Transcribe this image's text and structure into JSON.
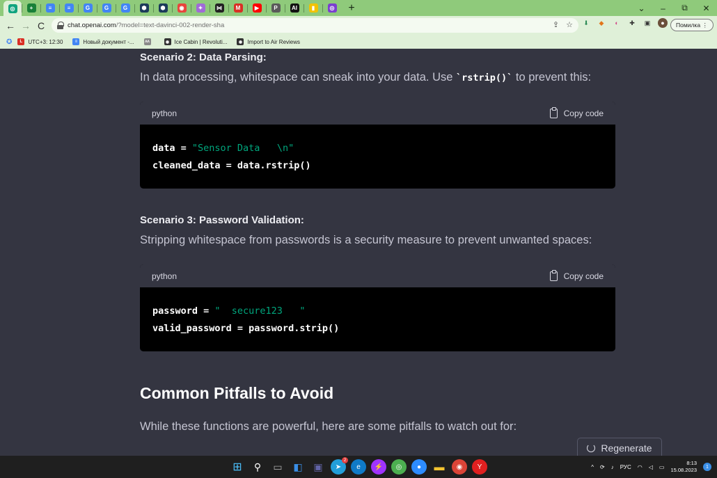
{
  "browser": {
    "tabs": [
      {
        "icon": "chatgpt-icon",
        "color": "#10a37f",
        "glyph": "◎",
        "active": true
      },
      {
        "icon": "sheets-plus-icon",
        "color": "#188038",
        "glyph": "+"
      },
      {
        "icon": "docs-icon",
        "color": "#4285f4",
        "glyph": "≡"
      },
      {
        "icon": "docs-icon",
        "color": "#4285f4",
        "glyph": "≡"
      },
      {
        "icon": "translate-icon",
        "color": "#4285f4",
        "glyph": "G"
      },
      {
        "icon": "translate-icon",
        "color": "#4285f4",
        "glyph": "G"
      },
      {
        "icon": "translate-icon",
        "color": "#4285f4",
        "glyph": "G"
      },
      {
        "icon": "hexagon-icon",
        "color": "#1c3b5a",
        "glyph": "⬢"
      },
      {
        "icon": "hexagon-icon",
        "color": "#1c3b5a",
        "glyph": "⬢"
      },
      {
        "icon": "target-icon",
        "color": "#e8453c",
        "glyph": "◉"
      },
      {
        "icon": "sparkle-icon",
        "color": "#a06bd8",
        "glyph": "✦"
      },
      {
        "icon": "bowtie-icon",
        "color": "#222222",
        "glyph": "⋈"
      },
      {
        "icon": "gmail-icon",
        "color": "#d93025",
        "glyph": "M"
      },
      {
        "icon": "youtube-icon",
        "color": "#ff0000",
        "glyph": "▶"
      },
      {
        "icon": "p-icon",
        "color": "#5a5a5a",
        "glyph": "P"
      },
      {
        "icon": "ai-icon",
        "color": "#111111",
        "glyph": "AI"
      },
      {
        "icon": "bars-icon",
        "color": "#f2c200",
        "glyph": "▮"
      },
      {
        "icon": "camera-lens-icon",
        "color": "#7b3fd0",
        "glyph": "◎"
      }
    ],
    "new_tab_label": "+",
    "window_controls": {
      "chevron": "⌄",
      "minimize": "–",
      "restore": "⧉",
      "close": "✕"
    },
    "nav": {
      "back": "←",
      "forward": "→",
      "reload": "C"
    },
    "url_host": "chat.openai.com",
    "url_path": "/?model=text-davinci-002-render-sha",
    "profile_label": "Помилка",
    "bookmarks": [
      {
        "label": "UTC+3: 12:30",
        "icon": "clock-app-icon",
        "color": "#d93025",
        "glyph": "L"
      },
      {
        "label": "Новый документ -...",
        "icon": "docs-icon",
        "color": "#4285f4",
        "glyph": "≡"
      },
      {
        "label": "",
        "icon": "mountain-icon",
        "color": "#8a8a8a",
        "glyph": "ʌʌ"
      },
      {
        "label": "Ice Cabin | Revoluti...",
        "icon": "globe-icon",
        "color": "#333333",
        "glyph": "◉"
      },
      {
        "label": "Import to Air Reviews",
        "icon": "globe-icon",
        "color": "#333333",
        "glyph": "◉"
      }
    ]
  },
  "page": {
    "scenario2_title": "Scenario 2: Data Parsing:",
    "scenario2_text_before": "In data processing, whitespace can sneak into your data. Use ",
    "scenario2_code": "`rstrip()`",
    "scenario2_text_after": " to prevent this:",
    "code1": {
      "lang": "python",
      "copy_label": "Copy code",
      "line1_a": "data = ",
      "line1_str": "\"Sensor Data   \\n\"",
      "line2": "cleaned_data = data.rstrip()"
    },
    "scenario3_title": "Scenario 3: Password Validation:",
    "scenario3_text": "Stripping whitespace from passwords is a security measure to prevent unwanted spaces:",
    "code2": {
      "lang": "python",
      "copy_label": "Copy code",
      "line1_a": "password = ",
      "line1_str": "\"  secure123   \"",
      "line2": "valid_password = password.strip()"
    },
    "heading": "Common Pitfalls to Avoid",
    "pitfalls_text": "While these functions are powerful, here are some pitfalls to watch out for:",
    "regenerate_label": "Regenerate"
  },
  "taskbar": {
    "lang": "РУС",
    "time": "8:13",
    "date": "15.08.2023",
    "notification_count": "1",
    "telegram_badge": "2"
  }
}
